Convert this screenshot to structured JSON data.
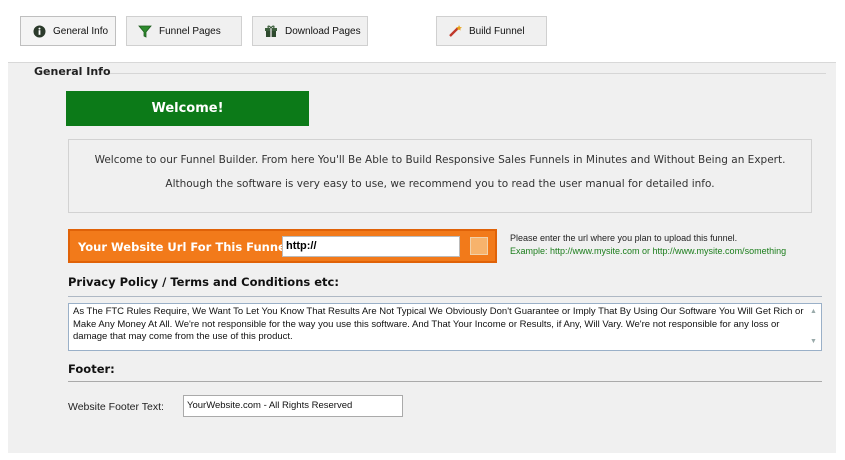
{
  "tabs": [
    {
      "label": "General Info",
      "icon": "info-icon"
    },
    {
      "label": "Funnel Pages",
      "icon": "funnel-icon"
    },
    {
      "label": "Download Pages",
      "icon": "gift-icon"
    },
    {
      "label": "Build Funnel",
      "icon": "magic-wand-icon"
    }
  ],
  "active_tab": "General Info",
  "group_title": "General Info",
  "welcome": {
    "heading": "Welcome!",
    "line1": "Welcome to our Funnel Builder. From here You'll Be Able to Build Responsive Sales Funnels in Minutes and Without Being an Expert.",
    "line2": "Although the software is very easy to use, we recommend you to read the user manual for detailed info."
  },
  "website_url": {
    "label": "Your Website Url For This Funnel:",
    "value": "http://",
    "hint": "Please enter the url where you plan to upload this funnel.",
    "example": "Example: http://www.mysite.com  or http://www.mysite.com/something"
  },
  "privacy": {
    "title": "Privacy Policy / Terms and Conditions etc:",
    "text": "As The FTC Rules Require, We Want To Let You Know That Results Are Not Typical We Obviously Don't Guarantee or Imply That By Using Our Software You Will Get Rich or Make Any Money At All. We're not responsible for the way you use this software. And That Your Income or Results, if Any, Will Vary. We're not responsible for any loss or damage that may come from the use of this product."
  },
  "footer": {
    "title": "Footer:",
    "label": "Website Footer Text:",
    "value": "YourWebsite.com - All Rights Reserved"
  },
  "colors": {
    "welcome_green": "#0c7a18",
    "url_orange": "#f27a1a",
    "example_green": "#1b7d1b"
  }
}
